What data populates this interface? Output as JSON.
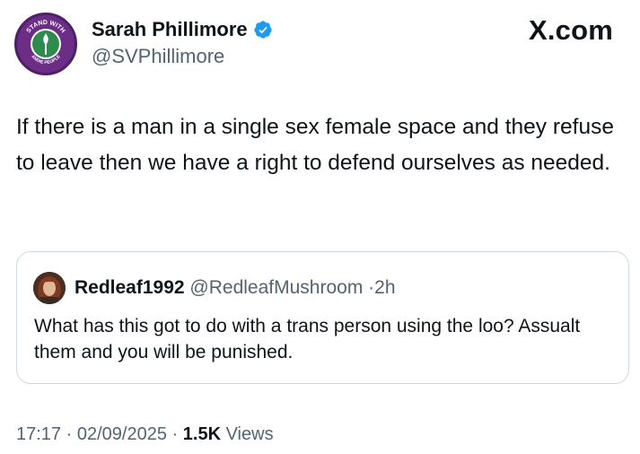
{
  "tweet": {
    "author": {
      "name": "Sarah Phillimore",
      "handle": "@SVPhillimore",
      "verified": true,
      "avatar_text_top": "STAND WITH",
      "avatar_text_bottom": "ANDIE PEOPLE"
    },
    "brand": "X.com",
    "text": "If there is a man in a single sex female space and they refuse to leave then we have a right to defend ourselves as needed.",
    "quote": {
      "name": "Redleaf1992",
      "handle": "@RedleafMushroom",
      "time": "2h",
      "text": "What has this got to do with a trans person using the loo? Assualt them and you will be punished."
    },
    "footer": {
      "time": "17:17",
      "date": "02/09/2025",
      "views_count": "1.5K",
      "views_label": "Views"
    }
  },
  "colors": {
    "verified": "#1d9bf0",
    "muted": "#536471",
    "text": "#0f1419",
    "border": "#cfd9de",
    "avatar_purple": "#6b2d86"
  }
}
